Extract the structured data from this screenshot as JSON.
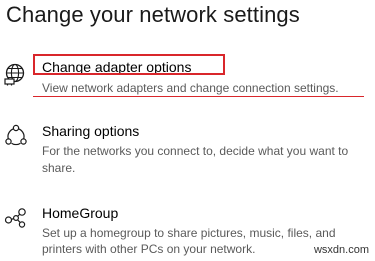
{
  "page": {
    "title": "Change your network settings"
  },
  "options": [
    {
      "title": "Change adapter options",
      "description": "View network adapters and change connection settings.",
      "icon": "globe-icon"
    },
    {
      "title": "Sharing options",
      "description": "For the networks you connect to, decide what you want to",
      "description_line2": "share.",
      "icon": "sharing-icon"
    },
    {
      "title": "HomeGroup",
      "description": "Set up a homegroup to share pictures, music, files, and",
      "description_line2": "printers with other PCs on your network.",
      "icon": "homegroup-icon"
    }
  ],
  "watermark": "wsxdn.com",
  "colors": {
    "highlight": "#d9262b",
    "description_text": "#5a5a5a"
  }
}
